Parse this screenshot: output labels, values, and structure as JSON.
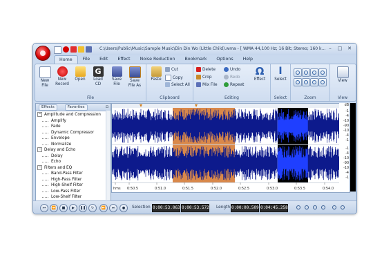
{
  "window": {
    "title": "C:\\Users\\Public\\Music\\Sample Music\\Din Din Wo (Little Child).wma - [ WMA 44,100 Hz; 16 Bit; Stereo; 160 k...",
    "controls": [
      "–",
      "□",
      "✕"
    ]
  },
  "tabs": [
    "Home",
    "File",
    "Edit",
    "Effect",
    "Noise Reduction",
    "Bookmark",
    "Options",
    "Help"
  ],
  "active_tab": "Home",
  "ribbon": {
    "file_group": {
      "label": "File",
      "buttons": [
        {
          "label": "New\nFile",
          "icon": "new-file-icon"
        },
        {
          "label": "New\nRecord",
          "icon": "record-icon"
        },
        {
          "label": "Open",
          "icon": "open-folder-icon"
        },
        {
          "label": "Load\nCD",
          "icon": "cd-icon"
        },
        {
          "label": "Save\nFile",
          "icon": "save-icon"
        },
        {
          "label": "Save\nFile As",
          "icon": "save-as-icon"
        }
      ]
    },
    "clipboard_group": {
      "label": "Clipboard",
      "paste": "Paste",
      "cut": "Cut",
      "copy": "Copy",
      "select_all": "Select All"
    },
    "editing_group": {
      "label": "Editing",
      "delete": "Delete",
      "crop": "Crop",
      "mix_file": "Mix File",
      "undo": "Undo",
      "redo": "Redo",
      "repeat": "Repeat",
      "effect": "Effect"
    },
    "select_group": {
      "label": "Select",
      "button": "Select"
    },
    "zoom_group": {
      "label": "Zoom"
    },
    "view_group": {
      "label": "View",
      "button": "View"
    }
  },
  "panel": {
    "tabs": [
      "Effects",
      "Favorites"
    ],
    "tree": [
      {
        "type": "cat",
        "label": "Amplitude and Compression"
      },
      {
        "type": "item",
        "label": "Amplify"
      },
      {
        "type": "item",
        "label": "Fade"
      },
      {
        "type": "item",
        "label": "Dynamic Compressor"
      },
      {
        "type": "item",
        "label": "Envelope"
      },
      {
        "type": "item",
        "label": "Normalize"
      },
      {
        "type": "cat",
        "label": "Delay and Echo"
      },
      {
        "type": "item",
        "label": "Delay"
      },
      {
        "type": "item",
        "label": "Echo"
      },
      {
        "type": "cat",
        "label": "Filters and EQ"
      },
      {
        "type": "item",
        "label": "Band-Pass Filter"
      },
      {
        "type": "item",
        "label": "High-Pass Filter"
      },
      {
        "type": "item",
        "label": "High-Shelf Filter"
      },
      {
        "type": "item",
        "label": "Low-Pass Filter"
      },
      {
        "type": "item",
        "label": "Low-Shelf Filter"
      }
    ]
  },
  "timeline": {
    "labels": [
      "hms",
      "0:50.5",
      "0:51.0",
      "0:51.5",
      "0:52.0",
      "0:52.5",
      "0:53.0",
      "0:53.5",
      "0:54.0"
    ]
  },
  "db_scale": {
    "header": "dB",
    "labels": [
      "-1",
      "-4",
      "-10",
      "-90",
      "-10",
      "-4",
      "-1",
      "-1",
      "-4",
      "-10",
      "-90",
      "-10",
      "-4",
      "-1"
    ]
  },
  "transport": {
    "selection_label": "Selection",
    "selection_start": "0:00:53.063",
    "selection_end": "0:00:53.572",
    "length_label": "Length",
    "length_value": "0:00:00.509",
    "total_length": "0:04:45.258"
  },
  "colors": {
    "waveform": "#0d1a8c",
    "selection": "#d9884a",
    "dark_region_wave": "#1f3fff",
    "dark_region_bg": "#000000"
  }
}
